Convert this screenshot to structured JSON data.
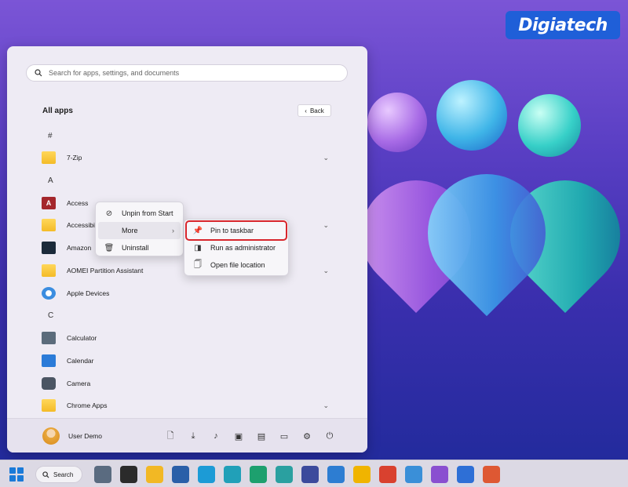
{
  "watermark": {
    "text": "Digiatech"
  },
  "search": {
    "placeholder": "Search for apps, settings, and documents"
  },
  "allapps": {
    "title": "All apps",
    "back_label": "Back"
  },
  "letters": [
    "#",
    "A",
    "C"
  ],
  "apps": [
    {
      "name": "7-Zip",
      "icon": "folder-icon",
      "has_chevron": true
    },
    {
      "name": "Access",
      "icon": "access-icon",
      "has_chevron": false
    },
    {
      "name": "Accessibility",
      "icon": "folder-icon",
      "has_chevron": true
    },
    {
      "name": "Amazon",
      "icon": "amazon-icon",
      "has_chevron": false
    },
    {
      "name": "AOMEI Partition Assistant",
      "icon": "folder-icon",
      "has_chevron": true
    },
    {
      "name": "Apple Devices",
      "icon": "apple-devices-icon",
      "has_chevron": false
    },
    {
      "name": "Calculator",
      "icon": "calculator-icon",
      "has_chevron": false
    },
    {
      "name": "Calendar",
      "icon": "calendar-icon",
      "has_chevron": false
    },
    {
      "name": "Camera",
      "icon": "camera-icon",
      "has_chevron": false
    },
    {
      "name": "Chrome Apps",
      "icon": "folder-icon",
      "has_chevron": true
    }
  ],
  "context_menu": {
    "items": [
      {
        "label": "Unpin from Start",
        "icon": "unpin-icon"
      },
      {
        "label": "More",
        "icon": "",
        "submenu": true
      },
      {
        "label": "Uninstall",
        "icon": "trash-icon"
      }
    ]
  },
  "submenu": {
    "items": [
      {
        "label": "Pin to taskbar",
        "icon": "pin-icon",
        "highlighted": true
      },
      {
        "label": "Run as administrator",
        "icon": "shield-window-icon"
      },
      {
        "label": "Open file location",
        "icon": "file-location-icon"
      }
    ]
  },
  "footer": {
    "user_name": "User Demo",
    "icons": [
      "document-icon",
      "downloads-icon",
      "music-icon",
      "pictures-icon",
      "videos-icon",
      "file-explorer-icon",
      "settings-icon",
      "power-icon"
    ]
  },
  "taskbar": {
    "search_label": "Search",
    "apps": [
      {
        "name": "settings",
        "color": "#5a6b80"
      },
      {
        "name": "terminal",
        "color": "#2b2b2b"
      },
      {
        "name": "file-explorer",
        "color": "#f2b824"
      },
      {
        "name": "powershell",
        "color": "#2a5fa8"
      },
      {
        "name": "edge",
        "color": "#1c9bd6"
      },
      {
        "name": "edge-beta",
        "color": "#21a0b8"
      },
      {
        "name": "edge-dev",
        "color": "#1da06e"
      },
      {
        "name": "edge-canary",
        "color": "#2aa0a0"
      },
      {
        "name": "snipping-tool",
        "color": "#3c4a9c"
      },
      {
        "name": "notepad",
        "color": "#2d7dd2"
      },
      {
        "name": "chrome-canary",
        "color": "#f0b400"
      },
      {
        "name": "chrome",
        "color": "#d9412f"
      },
      {
        "name": "photos",
        "color": "#3a8fd8"
      },
      {
        "name": "visual-studio",
        "color": "#8a4fd0"
      },
      {
        "name": "store",
        "color": "#2e6fd6"
      },
      {
        "name": "duckduckgo",
        "color": "#de5833"
      }
    ]
  }
}
